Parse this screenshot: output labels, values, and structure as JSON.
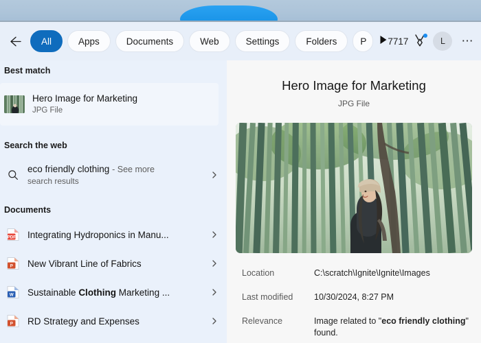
{
  "toolbar": {
    "back_icon": "back-arrow-icon",
    "pills": [
      {
        "label": "All",
        "active": true
      },
      {
        "label": "Apps",
        "active": false
      },
      {
        "label": "Documents",
        "active": false
      },
      {
        "label": "Web",
        "active": false
      },
      {
        "label": "Settings",
        "active": false
      },
      {
        "label": "Folders",
        "active": false
      },
      {
        "label": "P",
        "active": false,
        "clipped": true
      }
    ],
    "overflow_icon": "play-arrow-icon",
    "rewards_count": "7717",
    "rewards_icon": "medal-icon",
    "avatar_initial": "L",
    "more_icon": "ellipsis-icon",
    "copilot_icon": "copilot-icon"
  },
  "left": {
    "best_match_heading": "Best match",
    "best_match": {
      "title": "Hero Image for Marketing",
      "subtitle": "JPG File",
      "thumb_icon": "image-thumbnail"
    },
    "web_heading": "Search the web",
    "web_result": {
      "query": "eco friendly clothing",
      "see_more": "- See more",
      "line2": "search results",
      "search_icon": "search-icon",
      "chevron_icon": "chevron-right-icon"
    },
    "documents_heading": "Documents",
    "documents": [
      {
        "label": "Integrating Hydroponics in Manu...",
        "icon": "pdf-file-icon",
        "bold": ""
      },
      {
        "label": "New Vibrant Line of Fabrics",
        "icon": "powerpoint-file-icon",
        "bold": ""
      },
      {
        "label": "Sustainable Clothing Marketing ...",
        "icon": "word-file-icon",
        "bold": "Clothing"
      },
      {
        "label": "RD Strategy and Expenses",
        "icon": "powerpoint-file-icon",
        "bold": ""
      }
    ]
  },
  "preview": {
    "title": "Hero Image for Marketing",
    "subtitle": "JPG File",
    "image_alt": "bamboo-forest-photo",
    "meta": [
      {
        "key": "Location",
        "value": "C:\\scratch\\Ignite\\Ignite\\Images",
        "bold": ""
      },
      {
        "key": "Last modified",
        "value": "10/30/2024, 8:27 PM",
        "bold": ""
      },
      {
        "key": "Relevance",
        "value": "Image related to \"eco friendly clothing\" found.",
        "bold": "eco friendly clothing"
      }
    ]
  },
  "colors": {
    "accent": "#0f6cbd",
    "left_bg": "#eaf1fb",
    "right_bg": "#f7f7f7",
    "badge_dot": "#1a8cf0"
  }
}
